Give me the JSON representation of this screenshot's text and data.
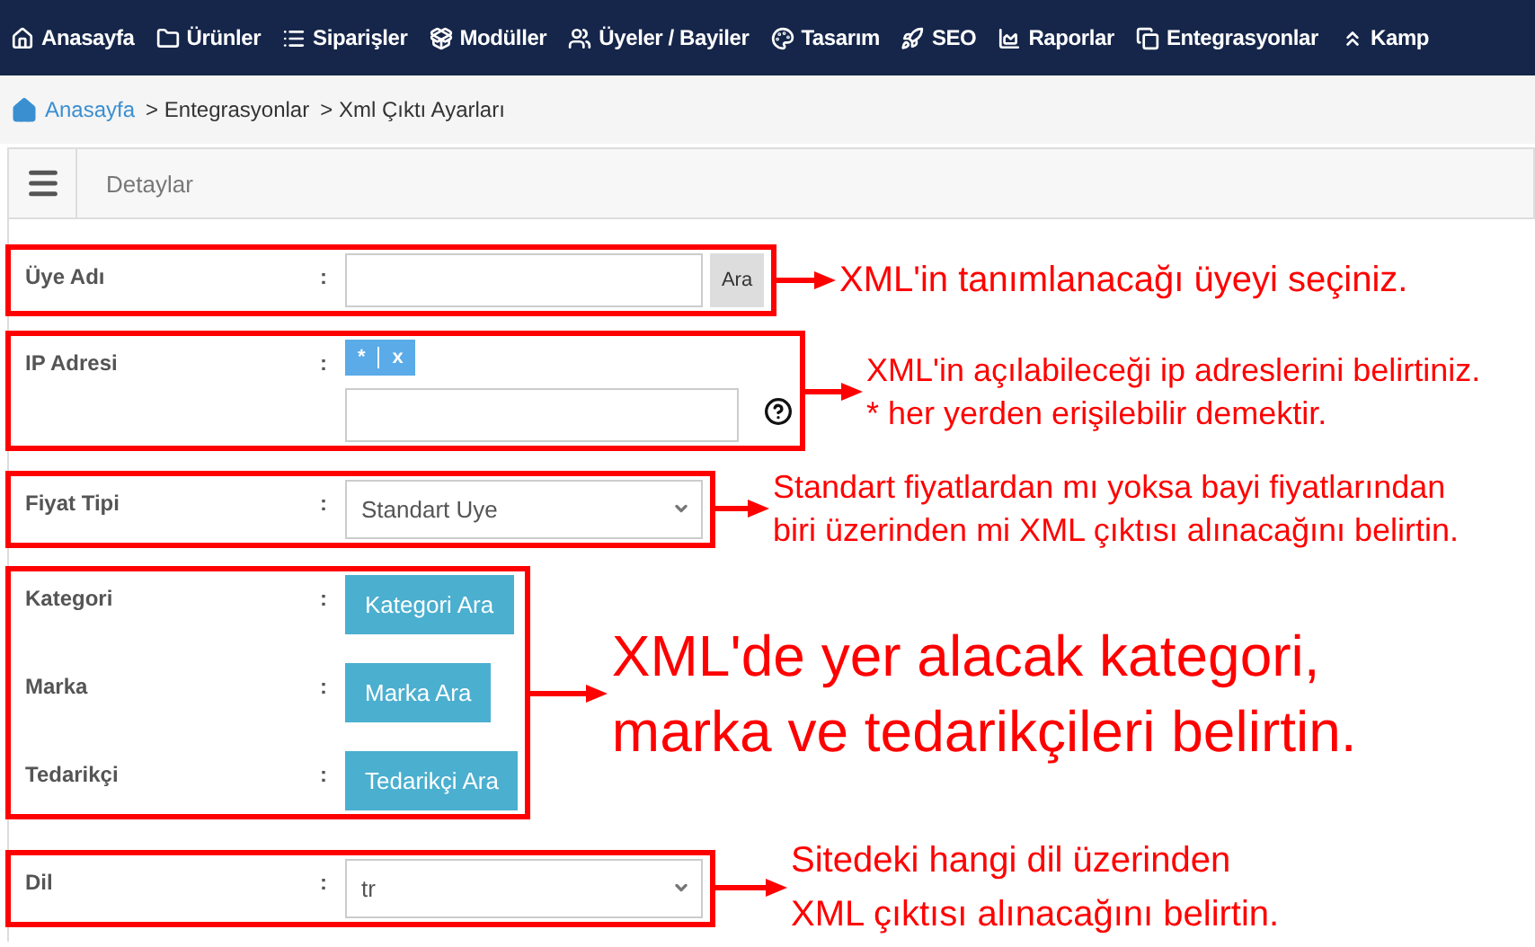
{
  "nav": [
    {
      "label": "Anasayfa"
    },
    {
      "label": "Ürünler"
    },
    {
      "label": "Siparişler"
    },
    {
      "label": "Modüller"
    },
    {
      "label": "Üyeler / Bayiler"
    },
    {
      "label": "Tasarım"
    },
    {
      "label": "SEO"
    },
    {
      "label": "Raporlar"
    },
    {
      "label": "Entegrasyonlar"
    },
    {
      "label": "Kamp"
    }
  ],
  "breadcrumb": [
    {
      "label": "Anasayfa",
      "link": true
    },
    {
      "label": "> Entegrasyonlar",
      "link": false
    },
    {
      "label": "> Xml Çıktı Ayarları",
      "link": false
    }
  ],
  "panel": {
    "title": "Detaylar"
  },
  "sections": [
    {
      "fields": [
        {
          "kind": "search",
          "label": "Üye Adı",
          "colon": ":",
          "button": "Ara"
        }
      ],
      "note": {
        "lines": [
          "XML'in tanımlanacağı üyeyi seçiniz."
        ]
      }
    },
    {
      "fields": [
        {
          "kind": "ip",
          "label": "IP Adresi",
          "colon": ":",
          "tag": "*",
          "remove": "x"
        }
      ],
      "note": {
        "lines": [
          "XML'in açılabileceği ip adreslerini belirtiniz.",
          "* her yerden erişilebilir demektir."
        ]
      }
    },
    {
      "fields": [
        {
          "kind": "select",
          "label": "Fiyat Tipi",
          "colon": ":",
          "value": "Standart Uye"
        }
      ],
      "note": {
        "lines": [
          "Standart fiyatlardan mı yoksa bayi fiyatlarından",
          "biri üzerinden mi XML çıktısı alınacağını belirtin."
        ]
      }
    },
    {
      "fields": [
        {
          "kind": "button",
          "label": "Kategori",
          "colon": ":",
          "button": "Kategori Ara"
        },
        {
          "kind": "button",
          "label": "Marka",
          "colon": ":",
          "button": "Marka Ara"
        },
        {
          "kind": "button",
          "label": "Tedarikçi",
          "colon": ":",
          "button": "Tedarikçi Ara"
        }
      ],
      "note": {
        "lines": [
          "XML'de yer alacak kategori,",
          "marka ve tedarikçileri belirtin."
        ]
      }
    },
    {
      "fields": [
        {
          "kind": "select",
          "label": "Dil",
          "colon": ":",
          "value": "tr"
        }
      ],
      "note": {
        "lines": [
          "Sitedeki hangi dil üzerinden",
          "XML çıktısı alınacağını belirtin."
        ]
      }
    }
  ]
}
